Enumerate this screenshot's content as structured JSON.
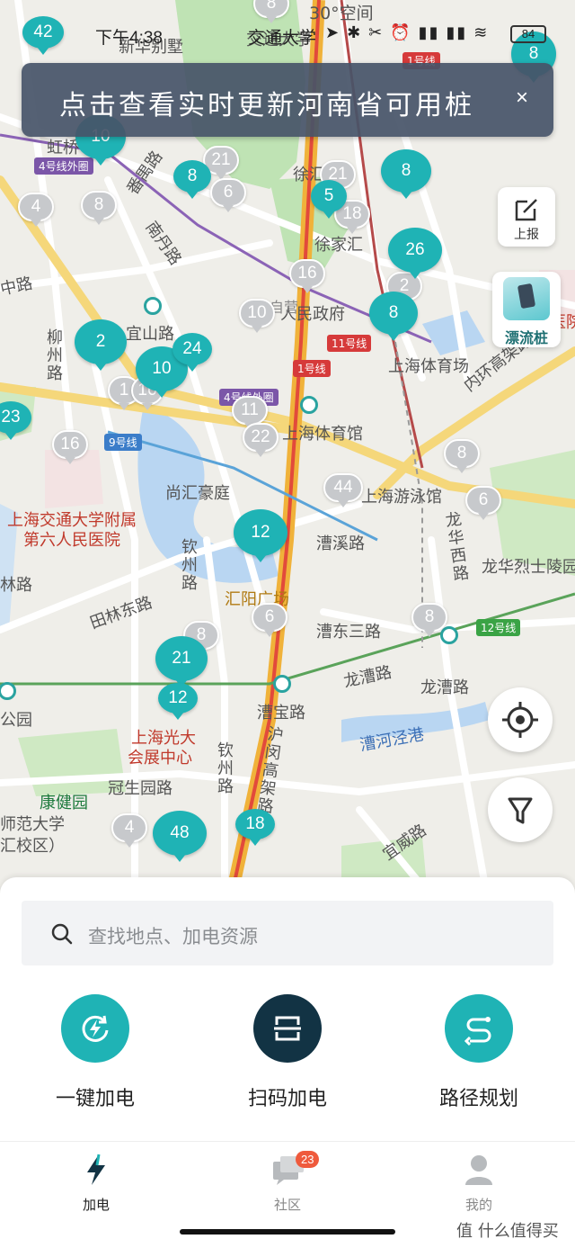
{
  "status_bar": {
    "time": "下午4:38",
    "network_label": "交通大学",
    "icons": "➤ ✱ ✂ ⏰ ▮▮ ▮▮ ≋",
    "battery": "84"
  },
  "banner": {
    "text": "点击查看实时更新河南省可用桩",
    "close": "×"
  },
  "map": {
    "places": [
      {
        "text": "新华别墅"
      },
      {
        "text": "30°空间"
      },
      {
        "text": "交通大学"
      },
      {
        "text": "虹桥"
      },
      {
        "text": "番禺路"
      },
      {
        "text": "南丹路"
      },
      {
        "text": "徐家汇"
      },
      {
        "text": "徐汇"
      },
      {
        "text": "中路"
      },
      {
        "text": "宜山路"
      },
      {
        "text": "人民政府"
      },
      {
        "text": "上海体育场"
      },
      {
        "text": "柳州路"
      },
      {
        "text": "上海体育馆"
      },
      {
        "text": "尚汇豪庭"
      },
      {
        "text": "上海游泳馆"
      },
      {
        "text": "内环高架路"
      },
      {
        "text": "上海交通大学附属"
      },
      {
        "text": "第六人民医院"
      },
      {
        "text": "林路"
      },
      {
        "text": "钦州路"
      },
      {
        "text": "汇阳广场"
      },
      {
        "text": "漕溪路"
      },
      {
        "text": "龙华西路"
      },
      {
        "text": "龙华烈士陵园"
      },
      {
        "text": "田林东路"
      },
      {
        "text": "漕东三路"
      },
      {
        "text": "龙漕路"
      },
      {
        "text": "龙漕路"
      },
      {
        "text": "公园"
      },
      {
        "text": "漕宝路"
      },
      {
        "text": "上海光大"
      },
      {
        "text": "会展中心"
      },
      {
        "text": "钦州路"
      },
      {
        "text": "漕河泾港"
      },
      {
        "text": "冠生园路"
      },
      {
        "text": "沪闵高架路"
      },
      {
        "text": "康健园"
      },
      {
        "text": "师范大学"
      },
      {
        "text": "汇校区）"
      },
      {
        "text": "宜威路"
      },
      {
        "text": "医院"
      },
      {
        "text": "自营"
      }
    ],
    "metro_labels": [
      {
        "text": "1号线"
      },
      {
        "text": "4号线外圈"
      },
      {
        "text": "11号线"
      },
      {
        "text": "1号线"
      },
      {
        "text": "4号线外圈"
      },
      {
        "text": "9号线"
      },
      {
        "text": "12号线"
      }
    ],
    "teal_markers": [
      {
        "count": "8"
      },
      {
        "count": "10"
      },
      {
        "count": "8"
      },
      {
        "count": "8"
      },
      {
        "count": "5"
      },
      {
        "count": "26"
      },
      {
        "count": "8"
      },
      {
        "count": "2"
      },
      {
        "count": "10"
      },
      {
        "count": "24"
      },
      {
        "count": "23"
      },
      {
        "count": "12"
      },
      {
        "count": "21"
      },
      {
        "count": "12"
      },
      {
        "count": "48"
      },
      {
        "count": "18"
      },
      {
        "count": "42"
      }
    ],
    "gray_markers": [
      {
        "count": "8"
      },
      {
        "count": "21"
      },
      {
        "count": "6"
      },
      {
        "count": "21"
      },
      {
        "count": "18"
      },
      {
        "count": "4"
      },
      {
        "count": "8"
      },
      {
        "count": "16"
      },
      {
        "count": "10"
      },
      {
        "count": "2"
      },
      {
        "count": "1"
      },
      {
        "count": "16"
      },
      {
        "count": "11"
      },
      {
        "count": "22"
      },
      {
        "count": "16"
      },
      {
        "count": "8"
      },
      {
        "count": "44"
      },
      {
        "count": "6"
      },
      {
        "count": "6"
      },
      {
        "count": "8"
      },
      {
        "count": "8"
      },
      {
        "count": "4"
      }
    ]
  },
  "report": {
    "label": "上报"
  },
  "drift": {
    "label": "漂流桩"
  },
  "search": {
    "placeholder": "查找地点、加电资源"
  },
  "actions": [
    {
      "label": "一键加电",
      "color": "#1fb3b5"
    },
    {
      "label": "扫码加电",
      "color": "#123344"
    },
    {
      "label": "路径规划",
      "color": "#1fb3b5"
    }
  ],
  "tabs": [
    {
      "label": "加电"
    },
    {
      "label": "社区",
      "badge": "23"
    },
    {
      "label": "我的"
    }
  ],
  "watermark": "值 什么值得买"
}
